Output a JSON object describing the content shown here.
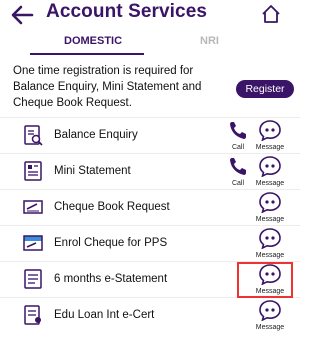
{
  "header": {
    "title": "Account Services"
  },
  "tabs": [
    {
      "label": "DOMESTIC"
    },
    {
      "label": "NRI"
    }
  ],
  "notice": {
    "text": "One time registration is required for Balance Enquiry, Mini Statement and Cheque Book Request.",
    "register_label": "Register"
  },
  "services": [
    {
      "label": "Balance Enquiry",
      "call_label": "Call",
      "message_label": "Message"
    },
    {
      "label": "Mini Statement",
      "call_label": "Call",
      "message_label": "Message"
    },
    {
      "label": "Cheque Book Request",
      "message_label": "Message"
    },
    {
      "label": "Enrol Cheque for PPS",
      "message_label": "Message"
    },
    {
      "label": "6 months e-Statement",
      "message_label": "Message"
    },
    {
      "label": "Edu Loan Int e-Cert",
      "message_label": "Message"
    }
  ],
  "colors": {
    "brand": "#3a1466",
    "highlight": "#e33333"
  }
}
